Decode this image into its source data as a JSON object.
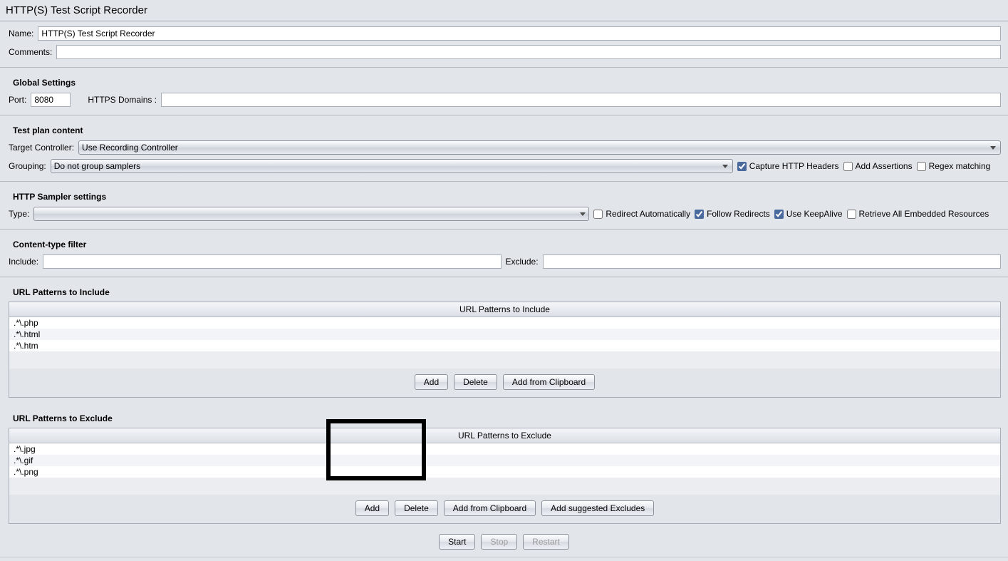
{
  "title": "HTTP(S) Test Script Recorder",
  "name": {
    "label": "Name:",
    "value": "HTTP(S) Test Script Recorder"
  },
  "comments": {
    "label": "Comments:",
    "value": ""
  },
  "global_settings": {
    "heading": "Global Settings",
    "port_label": "Port:",
    "port_value": "8080",
    "https_domains_label": "HTTPS Domains :",
    "https_domains_value": ""
  },
  "test_plan": {
    "heading": "Test plan content",
    "target_controller_label": "Target Controller:",
    "target_controller_value": "Use Recording Controller",
    "grouping_label": "Grouping:",
    "grouping_value": "Do not group samplers",
    "capture_headers_label": "Capture HTTP Headers",
    "capture_headers_checked": true,
    "add_assertions_label": "Add Assertions",
    "add_assertions_checked": false,
    "regex_matching_label": "Regex matching",
    "regex_matching_checked": false
  },
  "http_sampler": {
    "heading": "HTTP Sampler settings",
    "type_label": "Type:",
    "type_value": "",
    "redirect_auto_label": "Redirect Automatically",
    "redirect_auto_checked": false,
    "follow_redirects_label": "Follow Redirects",
    "follow_redirects_checked": true,
    "use_keepalive_label": "Use KeepAlive",
    "use_keepalive_checked": true,
    "retrieve_embedded_label": "Retrieve All Embedded Resources",
    "retrieve_embedded_checked": false
  },
  "content_type_filter": {
    "heading": "Content-type filter",
    "include_label": "Include:",
    "include_value": "",
    "exclude_label": "Exclude:",
    "exclude_value": ""
  },
  "patterns_include": {
    "heading": "URL Patterns to Include",
    "grid_header": "URL Patterns to Include",
    "rows": [
      ".*\\.php",
      ".*\\.html",
      ".*\\.htm"
    ],
    "btn_add": "Add",
    "btn_delete": "Delete",
    "btn_clipboard": "Add from Clipboard"
  },
  "patterns_exclude": {
    "heading": "URL Patterns to Exclude",
    "grid_header": "URL Patterns to Exclude",
    "rows": [
      ".*\\.jpg",
      ".*\\.gif",
      ".*\\.png"
    ],
    "btn_add": "Add",
    "btn_delete": "Delete",
    "btn_clipboard": "Add from Clipboard",
    "btn_suggested": "Add suggested Excludes"
  },
  "footer": {
    "btn_start": "Start",
    "btn_stop": "Stop",
    "btn_restart": "Restart"
  }
}
